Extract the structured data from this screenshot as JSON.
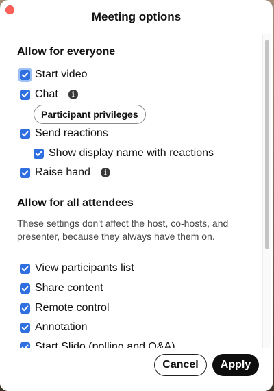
{
  "window": {
    "title": "Meeting options"
  },
  "section_everyone": {
    "title": "Allow for everyone",
    "options": [
      {
        "label": "Start video",
        "checked": true
      },
      {
        "label": "Chat",
        "checked": true
      },
      {
        "label": "Send reactions",
        "checked": true
      },
      {
        "label": "Show display name with reactions",
        "checked": true
      },
      {
        "label": "Raise hand",
        "checked": true
      }
    ],
    "participant_privileges_button": "Participant privileges"
  },
  "section_attendees": {
    "title": "Allow for all attendees",
    "description": "These settings don't affect the host, co-hosts, and presenter, because they always have them on.",
    "options": [
      {
        "label": "View participants list",
        "checked": true
      },
      {
        "label": "Share content",
        "checked": true
      },
      {
        "label": "Remote control",
        "checked": true
      },
      {
        "label": "Annotation",
        "checked": true
      },
      {
        "label": "Start Slido (polling and Q&A)",
        "checked": true
      }
    ]
  },
  "footer": {
    "cancel_label": "Cancel",
    "apply_label": "Apply"
  },
  "colors": {
    "checkbox": "#2f6fe0",
    "apply_button": "#0e0e0e",
    "close_dot": "#ff5f57"
  }
}
